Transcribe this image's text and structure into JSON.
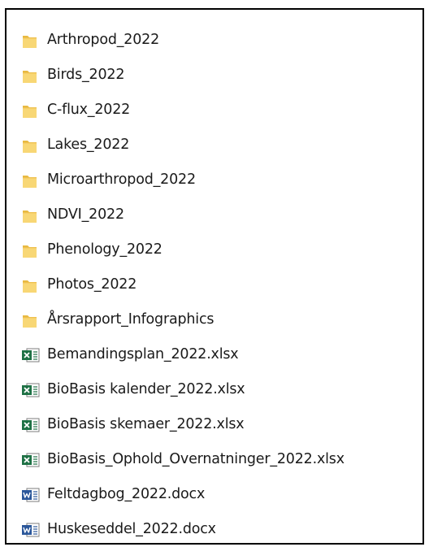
{
  "explorer": {
    "items": [
      {
        "name": "Arthropod_2022",
        "type": "folder",
        "icon": "folder-icon"
      },
      {
        "name": "Birds_2022",
        "type": "folder",
        "icon": "folder-icon"
      },
      {
        "name": "C-flux_2022",
        "type": "folder",
        "icon": "folder-icon"
      },
      {
        "name": "Lakes_2022",
        "type": "folder",
        "icon": "folder-icon"
      },
      {
        "name": "Microarthropod_2022",
        "type": "folder",
        "icon": "folder-icon"
      },
      {
        "name": "NDVI_2022",
        "type": "folder",
        "icon": "folder-icon"
      },
      {
        "name": "Phenology_2022",
        "type": "folder",
        "icon": "folder-icon"
      },
      {
        "name": "Photos_2022",
        "type": "folder",
        "icon": "folder-icon"
      },
      {
        "name": "Årsrapport_Infographics",
        "type": "folder",
        "icon": "folder-icon"
      },
      {
        "name": "Bemandingsplan_2022.xlsx",
        "type": "xlsx",
        "icon": "excel-file-icon"
      },
      {
        "name": "BioBasis kalender_2022.xlsx",
        "type": "xlsx",
        "icon": "excel-file-icon"
      },
      {
        "name": "BioBasis skemaer_2022.xlsx",
        "type": "xlsx",
        "icon": "excel-file-icon"
      },
      {
        "name": "BioBasis_Ophold_Overnatninger_2022.xlsx",
        "type": "xlsx",
        "icon": "excel-file-icon"
      },
      {
        "name": "Feltdagbog_2022.docx",
        "type": "docx",
        "icon": "word-file-icon"
      },
      {
        "name": "Huskeseddel_2022.docx",
        "type": "docx",
        "icon": "word-file-icon"
      }
    ]
  },
  "colors": {
    "folder_main": "#f8d775",
    "folder_back": "#e8b941",
    "excel_green": "#1e7145",
    "word_blue": "#2b579a",
    "text": "#1a1a1a",
    "frame": "#000000"
  }
}
